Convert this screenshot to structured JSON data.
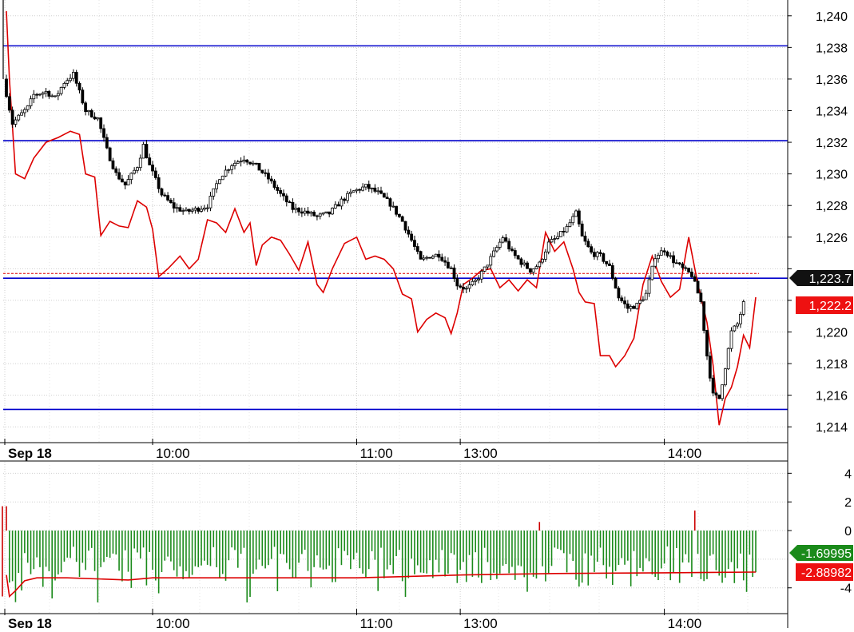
{
  "chart_data": [
    {
      "type": "candlestick",
      "panel": "price",
      "ylim": [
        1213,
        1241
      ],
      "yticks": [
        1214,
        1216,
        1218,
        1220,
        1222,
        1224,
        1226,
        1228,
        1230,
        1232,
        1234,
        1236,
        1238,
        1240
      ],
      "ytick_labels": [
        "1,214",
        "1,216",
        "1,218",
        "1,220",
        "",
        "",
        "1,226",
        "1,228",
        "1,230",
        "1,232",
        "1,234",
        "1,236",
        "1,238",
        "1,240"
      ],
      "xticks": [
        {
          "label": "Sep 18",
          "bold": true,
          "index": 0
        },
        {
          "label": "10:00",
          "bold": false,
          "index": 48
        },
        {
          "label": "11:00",
          "bold": false,
          "index": 115
        },
        {
          "label": "13:00",
          "bold": false,
          "index": 149
        },
        {
          "label": "14:00",
          "bold": false,
          "index": 216
        }
      ],
      "horizontal_lines": [
        1238.1,
        1232.1,
        1223.4,
        1215.1
      ],
      "last_price_line": 1223.7,
      "price_path": [
        [
          0,
          1236.0
        ],
        [
          3,
          1233.2
        ],
        [
          8,
          1234.2
        ],
        [
          10,
          1235.0
        ],
        [
          14,
          1235.2
        ],
        [
          17,
          1234.8
        ],
        [
          20,
          1235.8
        ],
        [
          23,
          1236.3
        ],
        [
          27,
          1234.0
        ],
        [
          31,
          1233.5
        ],
        [
          34,
          1231.5
        ],
        [
          37,
          1230.0
        ],
        [
          40,
          1229.3
        ],
        [
          44,
          1230.5
        ],
        [
          46,
          1231.8
        ],
        [
          48,
          1230.5
        ],
        [
          52,
          1228.7
        ],
        [
          56,
          1227.9
        ],
        [
          60,
          1227.6
        ],
        [
          64,
          1227.8
        ],
        [
          67,
          1228.0
        ],
        [
          71,
          1229.8
        ],
        [
          75,
          1230.6
        ],
        [
          79,
          1231.0
        ],
        [
          83,
          1230.5
        ],
        [
          87,
          1229.7
        ],
        [
          91,
          1228.7
        ],
        [
          95,
          1227.8
        ],
        [
          99,
          1227.6
        ],
        [
          103,
          1227.3
        ],
        [
          107,
          1227.5
        ],
        [
          111,
          1228.3
        ],
        [
          115,
          1228.9
        ],
        [
          119,
          1229.2
        ],
        [
          123,
          1228.8
        ],
        [
          127,
          1228.1
        ],
        [
          131,
          1227.0
        ],
        [
          134,
          1225.8
        ],
        [
          137,
          1224.5
        ],
        [
          140,
          1224.8
        ],
        [
          143,
          1224.9
        ],
        [
          147,
          1224.0
        ],
        [
          149,
          1223.0
        ],
        [
          152,
          1222.7
        ],
        [
          155,
          1223.2
        ],
        [
          158,
          1224.0
        ],
        [
          161,
          1225.0
        ],
        [
          164,
          1226.0
        ],
        [
          167,
          1225.0
        ],
        [
          170,
          1224.4
        ],
        [
          173,
          1223.9
        ],
        [
          176,
          1224.3
        ],
        [
          179,
          1225.6
        ],
        [
          182,
          1226.0
        ],
        [
          185,
          1226.6
        ],
        [
          188,
          1227.5
        ],
        [
          190,
          1226.0
        ],
        [
          193,
          1225.0
        ],
        [
          196,
          1224.8
        ],
        [
          199,
          1224.1
        ],
        [
          202,
          1222.2
        ],
        [
          205,
          1221.5
        ],
        [
          208,
          1221.7
        ],
        [
          211,
          1222.4
        ],
        [
          214,
          1224.8
        ],
        [
          217,
          1225.2
        ],
        [
          220,
          1224.5
        ],
        [
          223,
          1224.0
        ],
        [
          226,
          1223.6
        ],
        [
          229,
          1221.9
        ],
        [
          231,
          1218.5
        ],
        [
          233,
          1216.0
        ],
        [
          235,
          1215.8
        ],
        [
          237,
          1217.8
        ],
        [
          239,
          1220.0
        ],
        [
          241,
          1220.5
        ],
        [
          243,
          1221.8
        ],
        [
          245,
          1222.1
        ]
      ],
      "red_line_path": [
        [
          0,
          1240.3
        ],
        [
          1,
          1236.0
        ],
        [
          3,
          1230.0
        ],
        [
          6,
          1229.7
        ],
        [
          9,
          1231.0
        ],
        [
          13,
          1232.0
        ],
        [
          17,
          1232.3
        ],
        [
          21,
          1232.7
        ],
        [
          24,
          1232.5
        ],
        [
          26,
          1230.0
        ],
        [
          29,
          1229.8
        ],
        [
          31,
          1226.1
        ],
        [
          34,
          1227.0
        ],
        [
          37,
          1226.7
        ],
        [
          40,
          1226.6
        ],
        [
          43,
          1228.3
        ],
        [
          46,
          1227.9
        ],
        [
          48,
          1226.5
        ],
        [
          50,
          1223.5
        ],
        [
          53,
          1224.0
        ],
        [
          57,
          1224.8
        ],
        [
          60,
          1224.0
        ],
        [
          63,
          1224.6
        ],
        [
          66,
          1227.1
        ],
        [
          69,
          1226.9
        ],
        [
          72,
          1226.3
        ],
        [
          75,
          1227.8
        ],
        [
          78,
          1226.3
        ],
        [
          80,
          1226.9
        ],
        [
          82,
          1224.2
        ],
        [
          84,
          1225.5
        ],
        [
          87,
          1226.0
        ],
        [
          90,
          1225.8
        ],
        [
          93,
          1224.9
        ],
        [
          96,
          1223.9
        ],
        [
          99,
          1225.7
        ],
        [
          102,
          1223.0
        ],
        [
          104,
          1222.5
        ],
        [
          107,
          1224.0
        ],
        [
          111,
          1225.6
        ],
        [
          115,
          1226.0
        ],
        [
          118,
          1224.6
        ],
        [
          121,
          1224.8
        ],
        [
          124,
          1224.6
        ],
        [
          127,
          1224.0
        ],
        [
          130,
          1222.4
        ],
        [
          133,
          1222.1
        ],
        [
          135,
          1220.0
        ],
        [
          138,
          1220.8
        ],
        [
          141,
          1221.2
        ],
        [
          144,
          1220.9
        ],
        [
          146,
          1219.9
        ],
        [
          148,
          1221.2
        ],
        [
          150,
          1223.0
        ],
        [
          153,
          1223.4
        ],
        [
          156,
          1223.9
        ],
        [
          159,
          1224.0
        ],
        [
          162,
          1222.8
        ],
        [
          165,
          1223.3
        ],
        [
          168,
          1222.6
        ],
        [
          171,
          1223.3
        ],
        [
          174,
          1222.8
        ],
        [
          177,
          1226.3
        ],
        [
          180,
          1225.1
        ],
        [
          183,
          1225.7
        ],
        [
          186,
          1224.0
        ],
        [
          188,
          1222.5
        ],
        [
          190,
          1221.9
        ],
        [
          193,
          1221.8
        ],
        [
          195,
          1218.5
        ],
        [
          198,
          1218.5
        ],
        [
          200,
          1217.8
        ],
        [
          203,
          1218.5
        ],
        [
          206,
          1219.6
        ],
        [
          209,
          1223.0
        ],
        [
          212,
          1224.8
        ],
        [
          215,
          1223.2
        ],
        [
          218,
          1222.2
        ],
        [
          221,
          1222.7
        ],
        [
          224,
          1226.0
        ],
        [
          227,
          1223.0
        ],
        [
          230,
          1220.6
        ],
        [
          232,
          1217.9
        ],
        [
          234,
          1214.1
        ],
        [
          236,
          1215.8
        ],
        [
          238,
          1216.5
        ],
        [
          240,
          1217.8
        ],
        [
          242,
          1219.8
        ],
        [
          244,
          1219.0
        ],
        [
          246,
          1222.2
        ]
      ],
      "current_value_label": "1,223.7",
      "current_value_label_2": "1,222.2"
    },
    {
      "type": "bar+line",
      "panel": "oscillator",
      "ylim": [
        -5.8,
        4.8
      ],
      "yticks": [
        4,
        2,
        0,
        -4
      ],
      "ytick_labels": [
        "4",
        "2",
        "0",
        "-4"
      ],
      "xticks": [
        {
          "label": "Sep 18",
          "bold": true,
          "index": 0
        },
        {
          "label": "10:00",
          "bold": false,
          "index": 48
        },
        {
          "label": "11:00",
          "bold": false,
          "index": 115
        },
        {
          "label": "13:00",
          "bold": false,
          "index": 149
        },
        {
          "label": "14:00",
          "bold": false,
          "index": 216
        }
      ],
      "bar_colors": {
        "positive": "#cc0000",
        "negative": "#1a8a1a"
      },
      "signal_line_path": [
        [
          0,
          -3.1
        ],
        [
          1,
          -4.6
        ],
        [
          3,
          -4.2
        ],
        [
          6,
          -3.5
        ],
        [
          10,
          -3.3
        ],
        [
          20,
          -3.3
        ],
        [
          40,
          -3.45
        ],
        [
          48,
          -3.3
        ],
        [
          80,
          -3.3
        ],
        [
          115,
          -3.3
        ],
        [
          150,
          -3.1
        ],
        [
          180,
          -3.0
        ],
        [
          216,
          -2.95
        ],
        [
          246,
          -2.9
        ]
      ],
      "spikes": [
        {
          "index": 0,
          "value": 1.7
        },
        {
          "index": 175,
          "value": 0.6
        },
        {
          "index": 226,
          "value": 1.4
        }
      ],
      "current_value_label": "-1.69995",
      "current_value_label_2": "-2.88982"
    }
  ],
  "colors": {
    "background": "#ffffff",
    "grid": "#cfcfcf",
    "horizontal_line": "#0000cc",
    "candle_up_fill": "#ffffff",
    "candle_down_fill": "#000000",
    "red_line": "#dd0000",
    "dashed_price_line": "#dd0000",
    "label_black_bg": "#111111",
    "label_red_bg": "#ee1111",
    "label_green_bg": "#1a8a1a"
  }
}
